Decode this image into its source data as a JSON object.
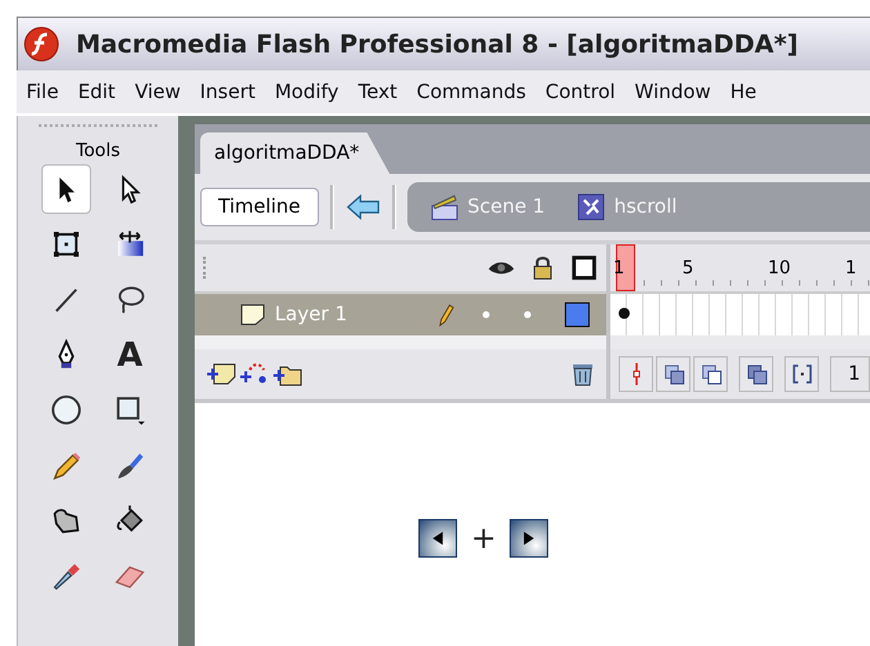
{
  "window": {
    "title": "Macromedia Flash Professional 8 - [algoritmaDDA*]"
  },
  "menu": [
    "File",
    "Edit",
    "View",
    "Insert",
    "Modify",
    "Text",
    "Commands",
    "Control",
    "Window",
    "He"
  ],
  "tools": {
    "title": "Tools",
    "items": [
      {
        "kind": "selection",
        "selected": true
      },
      {
        "kind": "subselection",
        "selected": false
      },
      {
        "kind": "transform",
        "selected": false
      },
      {
        "kind": "gradient",
        "selected": false
      },
      {
        "kind": "line",
        "selected": false
      },
      {
        "kind": "lasso",
        "selected": false
      },
      {
        "kind": "pen",
        "selected": false
      },
      {
        "kind": "text",
        "glyph": "A",
        "selected": false
      },
      {
        "kind": "oval",
        "selected": false
      },
      {
        "kind": "rectangle",
        "selected": false
      },
      {
        "kind": "pencil",
        "selected": false
      },
      {
        "kind": "brush",
        "selected": false
      },
      {
        "kind": "ink",
        "selected": false
      },
      {
        "kind": "bucket",
        "selected": false
      },
      {
        "kind": "dropper",
        "selected": false
      },
      {
        "kind": "eraser",
        "selected": false
      }
    ]
  },
  "document_tabs": [
    {
      "label": "algoritmaDDA*",
      "selected": true
    }
  ],
  "edit_bar": {
    "timeline_button": "Timeline",
    "breadcrumbs": [
      {
        "kind": "scene",
        "label": "Scene 1"
      },
      {
        "kind": "symbol",
        "label": "hscroll"
      }
    ]
  },
  "timeline": {
    "ruler": [
      "1",
      "5",
      "10",
      "1"
    ],
    "layers": [
      {
        "name": "Layer 1",
        "selected": true,
        "color": "#4a7cf0"
      }
    ],
    "frame_counter": "1"
  },
  "stage": {
    "items": [
      {
        "kind": "left-button"
      },
      {
        "kind": "plus",
        "label": "+"
      },
      {
        "kind": "right-button"
      }
    ]
  }
}
